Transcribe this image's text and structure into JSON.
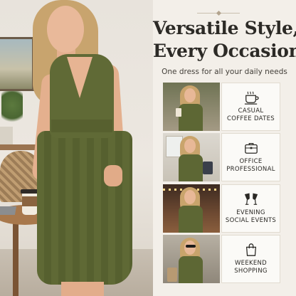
{
  "header": {
    "headline_line1": "Versatile Style,",
    "headline_line2": "Every Occasion",
    "subtitle": "One dress for all your daily needs"
  },
  "occasions": [
    {
      "icon": "coffee-cup-icon",
      "line1": "CASUAL",
      "line2": "COFFEE DATES"
    },
    {
      "icon": "briefcase-icon",
      "line1": "OFFICE",
      "line2": "PROFESSIONAL"
    },
    {
      "icon": "wine-glasses-icon",
      "line1": "EVENING",
      "line2": "SOCIAL EVENTS"
    },
    {
      "icon": "shopping-bag-icon",
      "line1": "WEEKEND",
      "line2": "SHOPPING"
    }
  ],
  "colors": {
    "dress_olive": "#606a36",
    "background": "#f3efe9",
    "text_dark": "#2c2a26"
  }
}
